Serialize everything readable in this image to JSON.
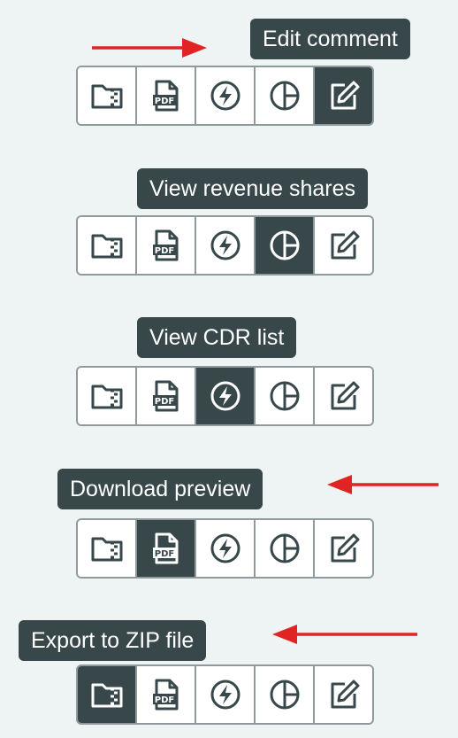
{
  "colors": {
    "background": "#eef3f4",
    "dark": "#37474a",
    "border": "#8f9a9c",
    "arrow": "#e02323"
  },
  "buttons": [
    {
      "icon": "folder-zip-icon"
    },
    {
      "icon": "pdf-file-icon",
      "text": "PDF"
    },
    {
      "icon": "lightning-icon"
    },
    {
      "icon": "pie-chart-icon"
    },
    {
      "icon": "edit-icon"
    }
  ],
  "panels": [
    {
      "tooltip": "Edit comment",
      "active_button": "edit-icon"
    },
    {
      "tooltip": "View revenue shares",
      "active_button": "pie-chart-icon"
    },
    {
      "tooltip": "View CDR list",
      "active_button": "lightning-icon"
    },
    {
      "tooltip": "Download preview",
      "active_button": "pdf-file-icon"
    },
    {
      "tooltip": "Export to ZIP file",
      "active_button": "folder-zip-icon"
    }
  ]
}
